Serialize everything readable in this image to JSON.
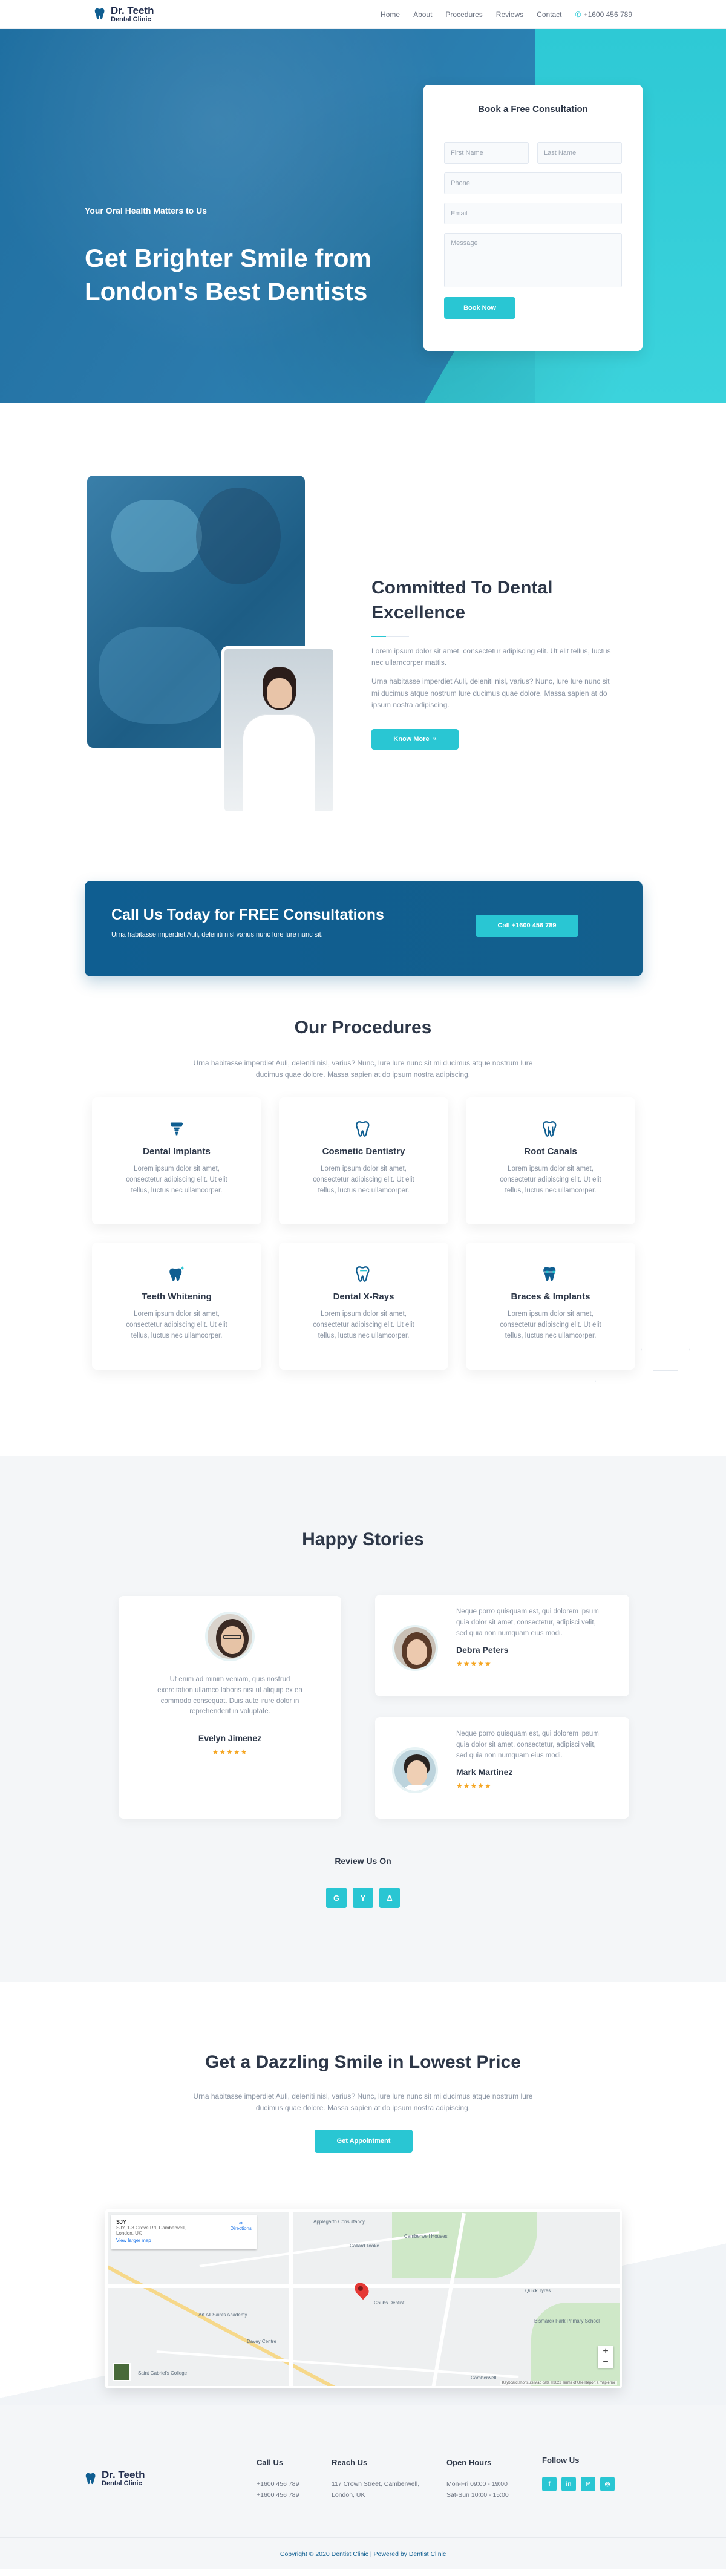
{
  "header": {
    "brand_line1": "Dr. Teeth",
    "brand_line2": "Dental Clinic",
    "nav": [
      "Home",
      "About",
      "Procedures",
      "Reviews",
      "Contact"
    ],
    "phone": "+1600 456 789"
  },
  "hero": {
    "kicker": "Your Oral Health Matters to Us",
    "heading": "Get Brighter Smile from London's Best Dentists",
    "form": {
      "title": "Book a Free Consultation",
      "first_name_placeholder": "First Name",
      "last_name_placeholder": "Last Name",
      "phone_placeholder": "Phone",
      "email_placeholder": "Email",
      "message_placeholder": "Message",
      "submit_label": "Book Now"
    }
  },
  "about": {
    "heading": "Committed To Dental Excellence",
    "para1": "Lorem ipsum dolor sit amet, consectetur adipiscing elit. Ut elit tellus, luctus nec ullamcorper mattis.",
    "para2": "Urna habitasse imperdiet Auli, deleniti nisl, varius? Nunc, lure lure nunc sit mi ducimus atque nostrum lure ducimus quae dolore. Massa sapien at do ipsum nostra adipiscing.",
    "button_label": "Know More"
  },
  "cta": {
    "heading": "Call Us Today for FREE Consultations",
    "text": "Urna habitasse imperdiet Auli, deleniti nisl varius nunc lure lure nunc sit.",
    "button_label": "Call +1600 456 789"
  },
  "procedures": {
    "title": "Our Procedures",
    "subtitle": "Urna habitasse imperdiet Auli, deleniti nisl, varius? Nunc, lure lure nunc sit mi ducimus atque nostrum lure ducimus quae dolore. Massa sapien at do ipsum nostra adipiscing.",
    "items": [
      {
        "title": "Dental Implants",
        "text": "Lorem ipsum dolor sit amet, consectetur adipiscing elit. Ut elit tellus, luctus nec ullamcorper."
      },
      {
        "title": "Cosmetic Dentistry",
        "text": "Lorem ipsum dolor sit amet, consectetur adipiscing elit. Ut elit tellus, luctus nec ullamcorper."
      },
      {
        "title": "Root Canals",
        "text": "Lorem ipsum dolor sit amet, consectetur adipiscing elit. Ut elit tellus, luctus nec ullamcorper."
      },
      {
        "title": "Teeth Whitening",
        "text": "Lorem ipsum dolor sit amet, consectetur adipiscing elit. Ut elit tellus, luctus nec ullamcorper."
      },
      {
        "title": "Dental X-Rays",
        "text": "Lorem ipsum dolor sit amet, consectetur adipiscing elit. Ut elit tellus, luctus nec ullamcorper."
      },
      {
        "title": "Braces & Implants",
        "text": "Lorem ipsum dolor sit amet, consectetur adipiscing elit. Ut elit tellus, luctus nec ullamcorper."
      }
    ]
  },
  "stories": {
    "title": "Happy Stories",
    "testimonials": [
      {
        "name": "Evelyn Jimenez",
        "text": "Ut enim ad minim veniam, quis nostrud exercitation ullamco laboris nisi ut aliquip ex ea commodo consequat. Duis aute irure dolor in reprehenderit in voluptate.",
        "stars": "★★★★★"
      },
      {
        "name": "Debra Peters",
        "text": "Neque porro quisquam est, qui dolorem ipsum quia dolor sit amet, consectetur, adipisci velit, sed quia non numquam eius modi.",
        "stars": "★★★★★"
      },
      {
        "name": "Mark Martinez",
        "text": "Neque porro quisquam est, qui dolorem ipsum quia dolor sit amet, consectetur, adipisci velit, sed quia non numquam eius modi.",
        "stars": "★★★★★"
      }
    ],
    "review_label": "Review Us On",
    "review_sites": [
      "G",
      "Y",
      "Δ"
    ]
  },
  "dazzle": {
    "title": "Get a Dazzling Smile in Lowest Price",
    "subtitle": "Urna habitasse imperdiet Auli, deleniti nisl, varius? Nunc, lure lure nunc sit mi ducimus atque nostrum lure ducimus quae dolore. Massa sapien at do ipsum nostra adipiscing.",
    "button_label": "Get Appointment"
  },
  "map": {
    "place_name": "SJY",
    "place_address": "SJY, 1-3 Grove Rd, Camberwell, London, UK",
    "directions_label": "Directions",
    "view_larger": "View larger map",
    "labels": [
      "Applegarth Consultancy",
      "Camberwell Houses",
      "Callard Tooke",
      "Chubs Dentist",
      "Saint Gabriel's College",
      "Art All Saints Academy",
      "Davey Centre",
      "Quick Tyres",
      "Bismarck Park Primary School",
      "Camberwell"
    ],
    "attribution": "Keyboard shortcuts  Map data ©2022  Terms of Use  Report a map error"
  },
  "footer": {
    "brand_line1": "Dr. Teeth",
    "brand_line2": "Dental Clinic",
    "call_us_title": "Call Us",
    "call_us_1": "+1600 456 789",
    "call_us_2": "+1600 456 789",
    "reach_title": "Reach Us",
    "reach_1": "117 Crown Street, Camberwell,",
    "reach_2": "London, UK",
    "hours_title": "Open Hours",
    "hours_1": "Mon-Fri 09:00 - 19:00",
    "hours_2": "Sat-Sun 10:00 - 15:00",
    "follow_title": "Follow Us",
    "socials": [
      "f",
      "in",
      "P",
      "◎"
    ],
    "copyright": "Copyright © 2020 Dentist Clinic | Powered by Dentist Clinic"
  },
  "colors": {
    "accent": "#29c6d3",
    "navy": "#0f5e91",
    "text": "#2d3748",
    "star": "#f5a623"
  }
}
